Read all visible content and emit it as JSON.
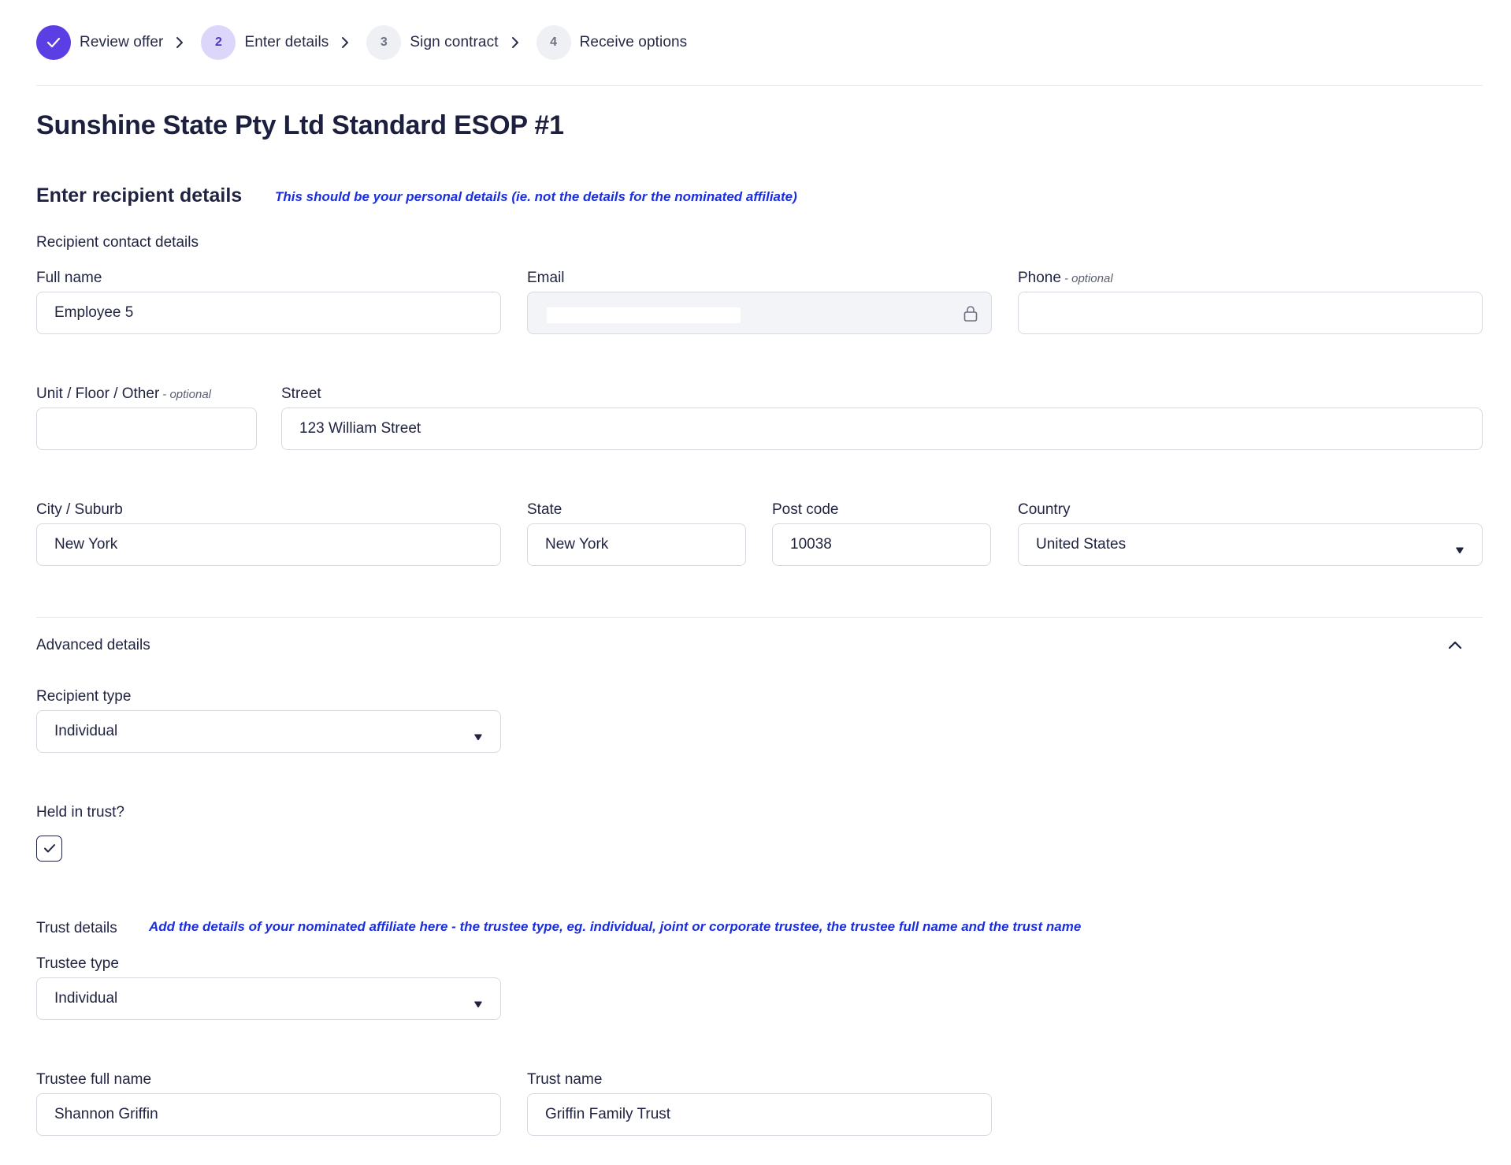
{
  "stepper": {
    "steps": [
      {
        "number": "",
        "label": "Review offer",
        "state": "done"
      },
      {
        "number": "2",
        "label": "Enter details",
        "state": "current"
      },
      {
        "number": "3",
        "label": "Sign contract",
        "state": "todo"
      },
      {
        "number": "4",
        "label": "Receive options",
        "state": "todo"
      }
    ],
    "accent_color": "#5b3fe4"
  },
  "page": {
    "title": "Sunshine State Pty Ltd Standard ESOP #1"
  },
  "recipient": {
    "section_title": "Enter recipient details",
    "hint": "This should be your personal details (ie. not the details for the nominated affiliate)",
    "contact_title": "Recipient contact details",
    "full_name": {
      "label": "Full name",
      "value": "Employee 5"
    },
    "email": {
      "label": "Email",
      "value": ""
    },
    "phone": {
      "label": "Phone",
      "optional": "- optional",
      "value": ""
    },
    "unit": {
      "label": "Unit / Floor / Other",
      "optional": "- optional",
      "value": ""
    },
    "street": {
      "label": "Street",
      "value": "123 William Street"
    },
    "city": {
      "label": "City / Suburb",
      "value": "New York"
    },
    "state": {
      "label": "State",
      "value": "New York"
    },
    "postcode": {
      "label": "Post code",
      "value": "10038"
    },
    "country": {
      "label": "Country",
      "value": "United States"
    }
  },
  "advanced": {
    "title": "Advanced details",
    "expanded": true,
    "recipient_type": {
      "label": "Recipient type",
      "value": "Individual"
    },
    "held_in_trust": {
      "label": "Held in trust?",
      "checked": true
    }
  },
  "trust": {
    "title": "Trust details",
    "hint": "Add the details of your nominated affiliate here - the trustee type, eg. individual, joint or corporate trustee, the trustee full name and the trust name",
    "trustee_type": {
      "label": "Trustee type",
      "value": "Individual"
    },
    "trustee_full_name": {
      "label": "Trustee full name",
      "value": "Shannon Griffin"
    },
    "trust_name": {
      "label": "Trust name",
      "value": "Griffin Family Trust"
    }
  }
}
